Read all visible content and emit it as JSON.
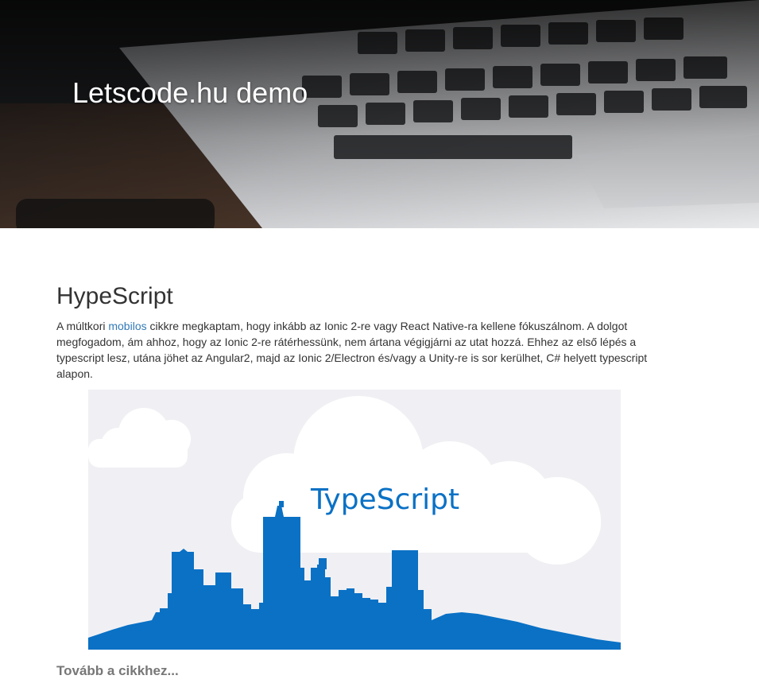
{
  "header": {
    "title": "Letscode.hu demo"
  },
  "article": {
    "title": "HypeScript",
    "intro_before_link": "A múltkori ",
    "link_text": "mobilos",
    "intro_after_link": " cikkre megkaptam, hogy inkább az Ionic 2-re vagy React Native-ra kellene fókuszálnom. A dolgot megfogadom, ám ahhoz, hogy az Ionic 2-re rátérhessünk, nem ártana végigjárni az utat hozzá. Ehhez az első lépés a typescript lesz, utána jöhet az Angular2, majd az Ionic 2/Electron és/vagy a Unity-re is sor kerülhet, C# helyett typescript alapon.",
    "image": {
      "logo_text": "TypeScript",
      "logo_color": "#0a71c5",
      "skyline_color": "#0a71c5",
      "background_color": "#f0f0f4"
    },
    "read_more": "Tovább a cikkhez..."
  },
  "colors": {
    "link": "#337ab7",
    "text": "#333333",
    "muted": "#777777"
  }
}
